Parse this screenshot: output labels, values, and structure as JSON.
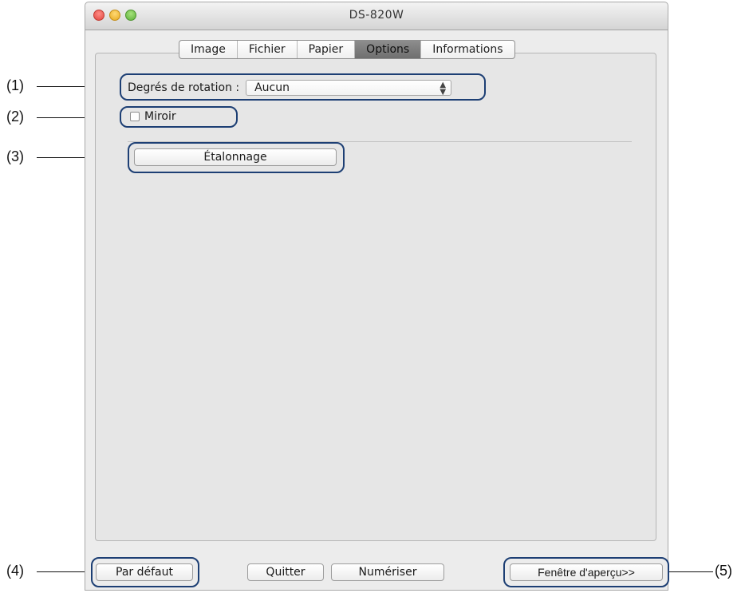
{
  "window": {
    "title": "DS-820W"
  },
  "tabs": [
    {
      "label": "Image",
      "active": false
    },
    {
      "label": "Fichier",
      "active": false
    },
    {
      "label": "Papier",
      "active": false
    },
    {
      "label": "Options",
      "active": true
    },
    {
      "label": "Informations",
      "active": false
    }
  ],
  "options": {
    "rotation_label": "Degrés de rotation :",
    "rotation_value": "Aucun",
    "mirror_label": "Miroir",
    "mirror_checked": false,
    "calibration_button": "Étalonnage"
  },
  "footer": {
    "default_button": "Par défaut",
    "quit_button": "Quitter",
    "scan_button": "Numériser",
    "preview_button": "Fenêtre d'aperçu>>"
  },
  "callouts": {
    "c1": "(1)",
    "c2": "(2)",
    "c3": "(3)",
    "c4": "(4)",
    "c5": "(5)"
  }
}
